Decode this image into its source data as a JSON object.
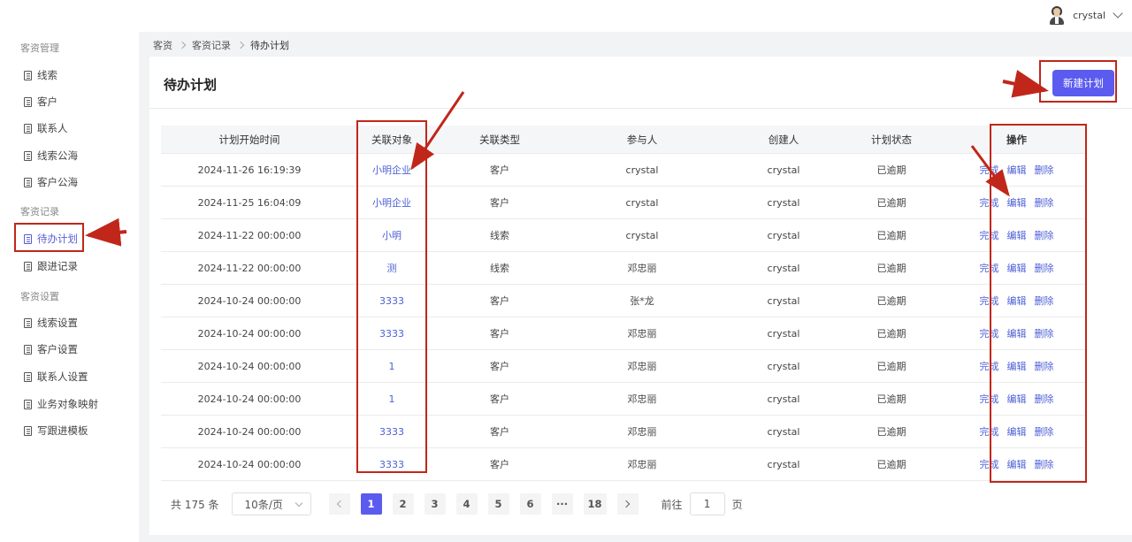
{
  "header": {
    "username": "crystal"
  },
  "sidebar": {
    "groups": [
      {
        "label": "客资管理"
      },
      {
        "label": "客资记录"
      },
      {
        "label": "客资设置"
      }
    ],
    "items": [
      {
        "label": "线索"
      },
      {
        "label": "客户"
      },
      {
        "label": "联系人"
      },
      {
        "label": "线索公海"
      },
      {
        "label": "客户公海"
      },
      {
        "label": "待办计划"
      },
      {
        "label": "跟进记录"
      },
      {
        "label": "线索设置"
      },
      {
        "label": "客户设置"
      },
      {
        "label": "联系人设置"
      },
      {
        "label": "业务对象映射"
      },
      {
        "label": "写跟进模板"
      }
    ]
  },
  "breadcrumb": [
    "客资",
    "客资记录",
    "待办计划"
  ],
  "page": {
    "title": "待办计划",
    "new_button": "新建计划"
  },
  "table": {
    "headers": [
      "计划开始时间",
      "关联对象",
      "关联类型",
      "参与人",
      "创建人",
      "计划状态",
      "操作"
    ],
    "actions": {
      "complete": "完成",
      "edit": "编辑",
      "delete": "删除"
    },
    "rows": [
      [
        "2024-11-26 16:19:39",
        "小明企业",
        "客户",
        "crystal",
        "crystal",
        "已逾期"
      ],
      [
        "2024-11-25 16:04:09",
        "小明企业",
        "客户",
        "crystal",
        "crystal",
        "已逾期"
      ],
      [
        "2024-11-22 00:00:00",
        "小明",
        "线索",
        "crystal",
        "crystal",
        "已逾期"
      ],
      [
        "2024-11-22 00:00:00",
        "测",
        "线索",
        "邓忠丽",
        "crystal",
        "已逾期"
      ],
      [
        "2024-10-24 00:00:00",
        "3333",
        "客户",
        "张*龙",
        "crystal",
        "已逾期"
      ],
      [
        "2024-10-24 00:00:00",
        "3333",
        "客户",
        "邓忠丽",
        "crystal",
        "已逾期"
      ],
      [
        "2024-10-24 00:00:00",
        "1",
        "客户",
        "邓忠丽",
        "crystal",
        "已逾期"
      ],
      [
        "2024-10-24 00:00:00",
        "1",
        "客户",
        "邓忠丽",
        "crystal",
        "已逾期"
      ],
      [
        "2024-10-24 00:00:00",
        "3333",
        "客户",
        "邓忠丽",
        "crystal",
        "已逾期"
      ],
      [
        "2024-10-24 00:00:00",
        "3333",
        "客户",
        "邓忠丽",
        "crystal",
        "已逾期"
      ]
    ]
  },
  "pagination": {
    "total_text": "共 175 条",
    "page_size": "10条/页",
    "pages": [
      "1",
      "2",
      "3",
      "4",
      "5",
      "6",
      "···",
      "18"
    ],
    "current_page": "1",
    "goto_prefix": "前往",
    "goto_value": "1",
    "goto_suffix": "页"
  },
  "colors": {
    "accent": "#5b5bf0",
    "link": "#4c5fd6",
    "annotation": "#c0271a"
  }
}
